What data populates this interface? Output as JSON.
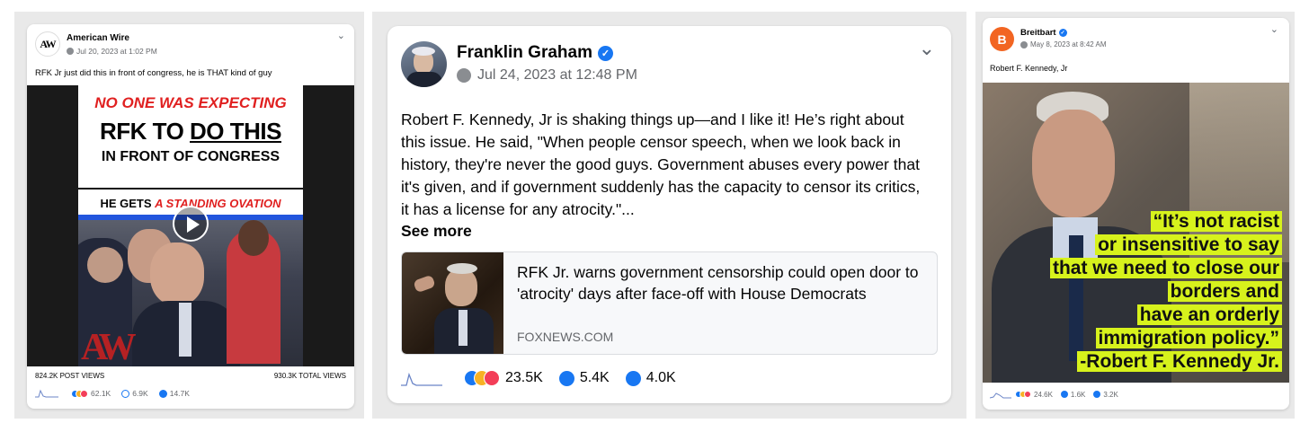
{
  "post1": {
    "author": "American Wire",
    "logo_text": "AW",
    "date": "Jul 20, 2023 at 1:02 PM",
    "text": "RFK Jr just did this in front of congress, he is THAT kind of guy",
    "thumb": {
      "line1": "NO ONE WAS EXPECTING",
      "line2a": "RFK TO ",
      "line2b": "DO THIS",
      "line3": "IN FRONT OF CONGRESS",
      "line4a": "HE GETS ",
      "line4b": "A STANDING OVATION",
      "watermark": "AW"
    },
    "post_views": "824.2K POST VIEWS",
    "total_views": "930.3K TOTAL VIEWS",
    "reactions": "62.1K",
    "comments": "6.9K",
    "shares": "14.7K"
  },
  "post2": {
    "author": "Franklin Graham",
    "date": "Jul 24, 2023 at 12:48 PM",
    "text": "Robert F. Kennedy, Jr is shaking things up—and I like it! He’s right about this issue. He said, \"When people censor speech, when we look back in history, they're never the good guys. Government abuses every power that it's given, and if government suddenly has the capacity to censor its critics, it has a license for any atrocity.\"...",
    "see_more": "See more",
    "link_title": "RFK Jr. warns government censorship could open door to 'atrocity' days after face-off with House Democrats",
    "link_source": "FOXNEWS.COM",
    "reactions": "23.5K",
    "comments": "5.4K",
    "shares": "4.0K"
  },
  "post3": {
    "author": "Breitbart",
    "logo_text": "B",
    "date": "May 8, 2023 at 8:42 AM",
    "text": "Robert F. Kennedy, Jr",
    "quote": [
      "“It’s not racist",
      "or insensitive to say",
      "that we need to close our",
      "borders and",
      "have an orderly",
      "immigration policy.”",
      "-Robert F. Kennedy Jr."
    ],
    "reactions": "24.6K",
    "comments": "1.6K",
    "shares": "3.2K"
  },
  "colors": {
    "fb_blue": "#1877f2",
    "quote_bg": "#d7f21c",
    "headline_red": "#e02020"
  },
  "icons": [
    "globe-icon",
    "chevron-down-icon",
    "verified-icon",
    "play-icon",
    "comment-icon",
    "share-icon",
    "like-icon",
    "sparkline-icon"
  ]
}
